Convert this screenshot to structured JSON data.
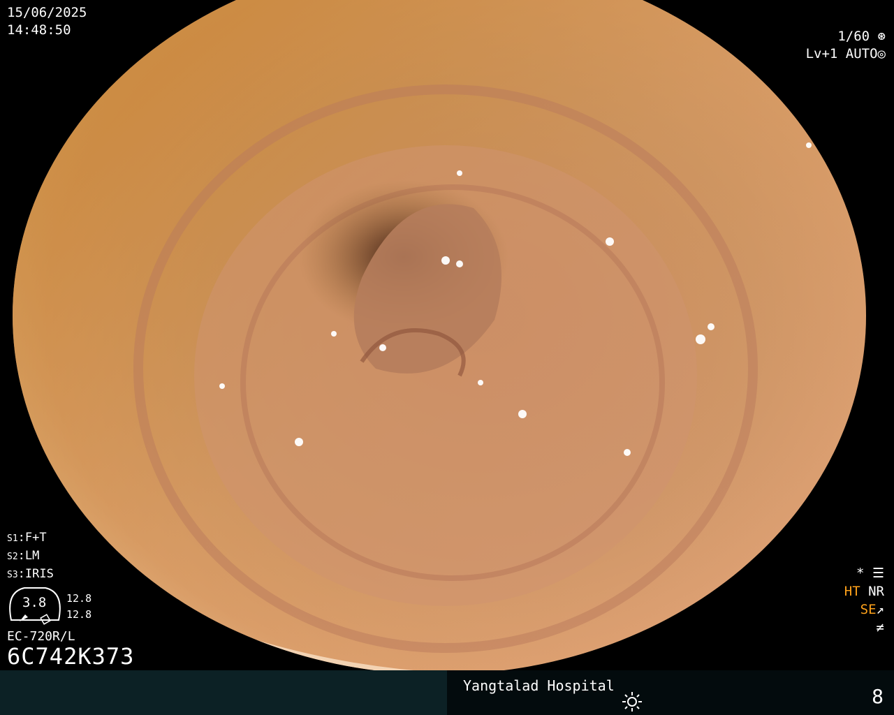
{
  "overlay": {
    "date": "15/06/2025",
    "time": "14:48:50",
    "shutter": "1/60",
    "shutter_icon": "aperture-icon",
    "light_level": "Lv+1",
    "mode": "AUTO",
    "mode_icon": "iris-icon",
    "settings": [
      {
        "key": "S1",
        "value": "F+T"
      },
      {
        "key": "S2",
        "value": "LM"
      },
      {
        "key": "S3",
        "value": "IRIS"
      }
    ],
    "gauge_value": "3.8",
    "gauge_numbers": [
      "12.8",
      "12.8"
    ],
    "scope_model": "EC-720R/L",
    "serial": "6C742K373",
    "star_icon": "*",
    "status_row_1": [
      "HT",
      "NR"
    ],
    "status_row_2": [
      "SE"
    ],
    "colors": {
      "highlight": "#ffa21a",
      "footer_left": "#0c2125",
      "footer_right": "#030b0d"
    }
  },
  "footer": {
    "hospital": "Yangtalad Hospital",
    "brightness_icon": "brightness-icon",
    "frame_number": "8"
  }
}
